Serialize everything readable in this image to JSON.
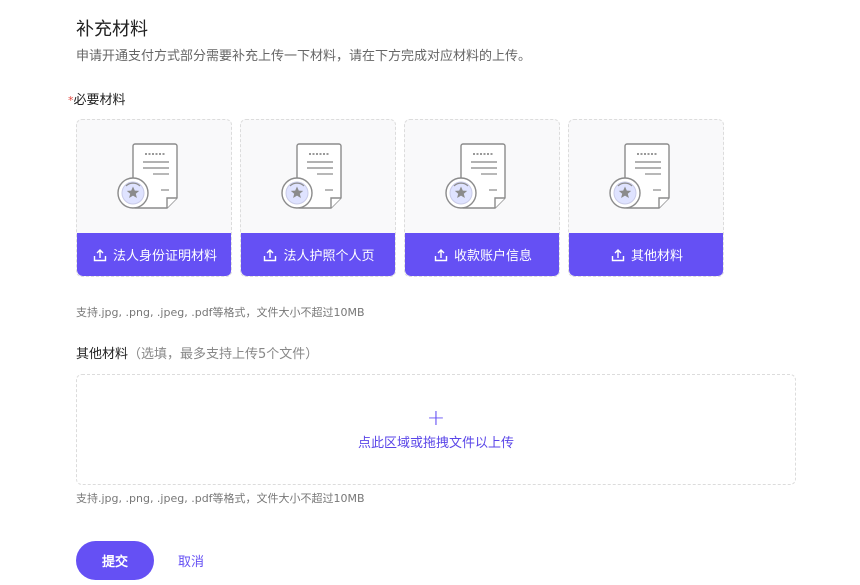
{
  "header": {
    "title": "补充材料",
    "subtitle": "申请开通支付方式部分需要补充上传一下材料，请在下方完成对应材料的上传。"
  },
  "required": {
    "star": "*",
    "label": "必要材料",
    "cards": [
      {
        "label": "法人身份证明材料"
      },
      {
        "label": "法人护照个人页"
      },
      {
        "label": "收款账户信息"
      },
      {
        "label": "其他材料"
      }
    ],
    "hint": "支持.jpg, .png, .jpeg, .pdf等格式，文件大小不超过10MB"
  },
  "optional": {
    "label": "其他材料",
    "note": "（选填，最多支持上传5个文件）",
    "dropzone_icon": "+",
    "dropzone_text": "点此区域或拖拽文件以上传",
    "hint": "支持.jpg, .png, .jpeg, .pdf等格式，文件大小不超过10MB"
  },
  "actions": {
    "submit_label": "提交",
    "cancel_label": "取消"
  },
  "colors": {
    "accent": "#6550f4",
    "required_star": "#e5483f"
  },
  "icons": {
    "card_illustration": "document-certificate-icon",
    "card_button": "upload-icon",
    "dropzone": "plus-icon"
  }
}
